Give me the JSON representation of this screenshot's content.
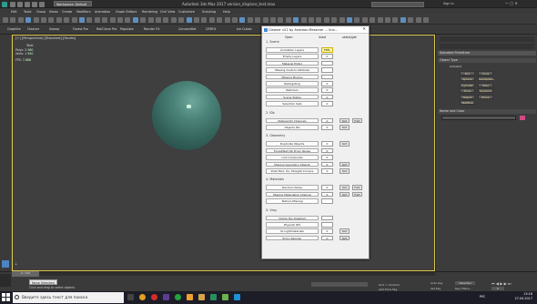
{
  "app": {
    "title": "Autodesk 3ds Max 2017    version_displace_test.max",
    "workspace": "Workspace: Default"
  },
  "menubar": [
    "Edit",
    "Tools",
    "Group",
    "Views",
    "Create",
    "Modifiers",
    "Animation",
    "Graph Editors",
    "Rendering",
    "Civil View",
    "Customize",
    "Scripting",
    "Help"
  ],
  "toolbar2": [
    "Graphite",
    "Cleaner",
    "Sweep",
    "Forest Pro",
    "RailClone Pro",
    "Populate",
    "Render FX",
    "ConnectSet",
    "CRRFX",
    "Ice Cubes",
    "Asset Tracking"
  ],
  "viewport": {
    "label": "[+] [Perspective] [Standard] [Facets]",
    "stats": {
      "total_label": "Total",
      "polys_label": "Polys:",
      "polys": "2 960",
      "verts_label": "Verts:",
      "verts": "1 940",
      "fps_label": "FPS:",
      "fps": "7.868"
    }
  },
  "dialog": {
    "title": "Cleaner v21 by Andreas Messmer ... line...",
    "tabs": [
      "Open",
      "Used",
      "select/get"
    ],
    "sections": [
      {
        "title": "1. Scene",
        "rows": [
          {
            "label": "Animation Layers",
            "count": "FEEL",
            "b1": "",
            "b2": "",
            "warn": true
          },
          {
            "label": "Empty Layers",
            "count": "0",
            "b1": "",
            "b2": ""
          },
          {
            "label": "Material Editor",
            "count": "",
            "b1": "",
            "b2": ""
          },
          {
            "label": "Missing Custom Attribute",
            "count": "",
            "b1": "",
            "b2": ""
          },
          {
            "label": "Missing Plugins",
            "count": "",
            "b1": "",
            "b2": ""
          },
          {
            "label": "Retargeting",
            "count": "0",
            "b1": "",
            "b2": ""
          },
          {
            "label": "Retimers",
            "count": "0",
            "b1": "",
            "b2": ""
          },
          {
            "label": "Scene States",
            "count": "0",
            "b1": "",
            "b2": ""
          },
          {
            "label": "Selection Sets",
            "count": "0",
            "b1": "",
            "b2": ""
          }
        ]
      },
      {
        "title": "2. IDs",
        "rows": [
          {
            "label": "Material ID Channels",
            "count": "0",
            "b1": "Slct",
            "b2": "Fixit"
          },
          {
            "label": "Objects IDs",
            "count": "0",
            "b1": "Slct",
            "b2": ""
          }
        ]
      },
      {
        "title": "3. Geometry",
        "rows": [
          {
            "label": "Duplicate Objects",
            "count": "0",
            "b1": "Slct",
            "b2": ""
          },
          {
            "label": "Forest/Rail Ob Proxy Reuse",
            "count": "0",
            "b1": "",
            "b2": ""
          },
          {
            "label": "Link Composite",
            "count": "0",
            "b1": "",
            "b2": ""
          },
          {
            "label": "Missing Geometry Objects",
            "count": "0",
            "b1": "Slct",
            "b2": ""
          },
          {
            "label": "Shell Mod. Ov. Straight Corners",
            "count": "0",
            "b1": "Slct",
            "b2": ""
          }
        ]
      },
      {
        "title": "4. Materials",
        "rows": [
          {
            "label": "Random Noise",
            "count": "0",
            "b1": "Slct",
            "b2": "Fixit"
          },
          {
            "label": "Missing Materialize Channel",
            "count": "0",
            "b1": "Slct",
            "b2": "Fixit"
          },
          {
            "label": "Texture Missing",
            "count": "",
            "b1": "",
            "b2": ""
          }
        ]
      },
      {
        "title": "5. Vray",
        "rows": [
          {
            "label": "Clamp Tex Disabled",
            "count": "",
            "b1": "",
            "b2": ""
          },
          {
            "label": "Physcell IDS",
            "count": "",
            "b1": "",
            "b2": ""
          },
          {
            "label": "GI Lightmaterials",
            "count": "0",
            "b1": "Slct",
            "b2": ""
          },
          {
            "label": "Proxy Reorder",
            "count": "0",
            "b1": "Slct",
            "b2": ""
          }
        ]
      }
    ]
  },
  "rightpanel": {
    "header": "Standard Primitives",
    "object_type": "Object Type",
    "autogrid": "AutoGrid",
    "buttons": [
      "Box",
      "Cone",
      "Sphere",
      "GeoSphere",
      "Cylinder",
      "Tube",
      "Torus",
      "Pyramid",
      "Teapot",
      "Plane",
      "TextPlus"
    ],
    "name_color": "Name and Color"
  },
  "status": {
    "tooltip": "None Selected",
    "message": "Click and drag to select objects",
    "add_time_tag": "Add Time Tag",
    "grid": "Grid = 10,0mm",
    "auto_key": "Auto Key",
    "set_key": "Set Key",
    "selected": "Selected",
    "key_filters": "Key Filters...",
    "frame": "0",
    "timeline": "0 / 100"
  },
  "taskbar": {
    "search_placeholder": "Введите здесь текст для поиска",
    "time": "13:18",
    "date": "27.04.2017",
    "lang": "РУС"
  },
  "colors": {
    "viewport_border": "#dcc74a",
    "sphere": "#4c847a",
    "accent": "#e8d59a"
  }
}
